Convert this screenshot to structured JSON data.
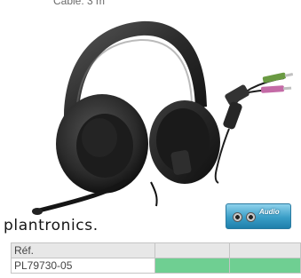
{
  "caption": "Câble: 3 m",
  "brand": {
    "name": "plantronics",
    "dot": "."
  },
  "audio_badge": {
    "label": "Audio"
  },
  "table": {
    "header": [
      "Réf.",
      "",
      ""
    ],
    "rows": [
      [
        "PL79730-05",
        "",
        ""
      ]
    ]
  },
  "colors": {
    "accent_green": "#6fcf92",
    "badge_blue": "#3a9ec7"
  }
}
